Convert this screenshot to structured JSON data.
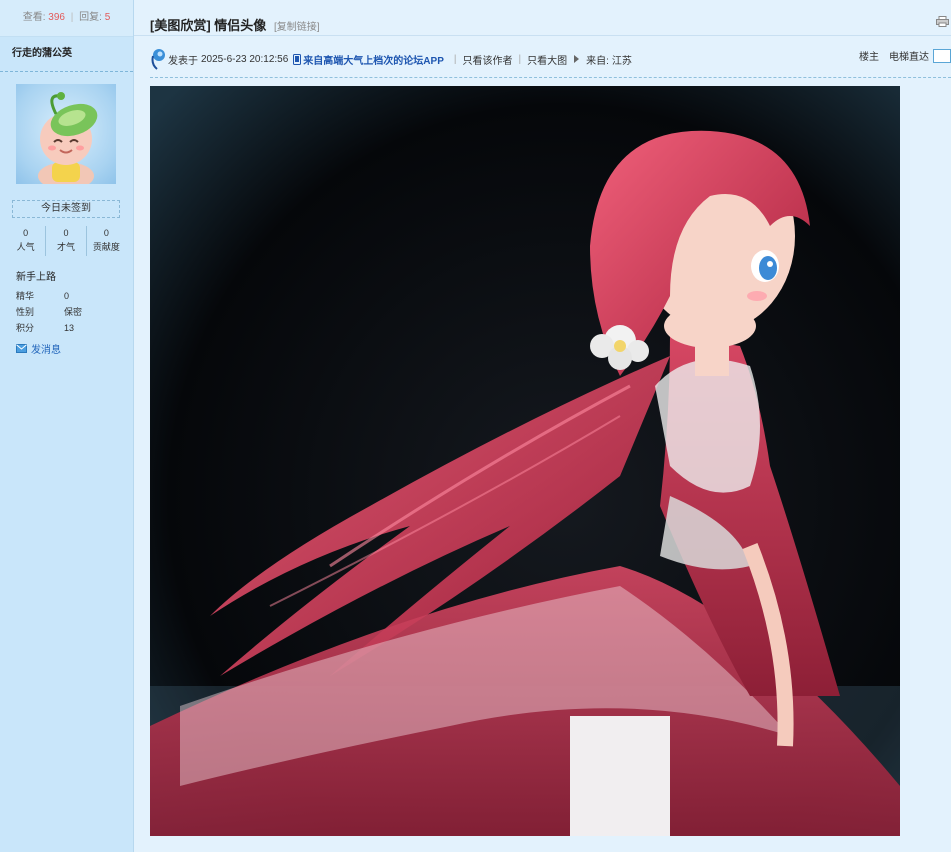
{
  "sidebar": {
    "views_label": "查看:",
    "views": "396",
    "replies_label": "回复:",
    "replies": "5",
    "username": "行走的蒲公英",
    "signin": "今日未签到",
    "stats": [
      {
        "value": "0",
        "label": "人气"
      },
      {
        "value": "0",
        "label": "才气"
      },
      {
        "value": "0",
        "label": "贡献度"
      }
    ],
    "rank": "新手上路",
    "info": [
      {
        "key": "精华",
        "value": "0"
      },
      {
        "key": "性别",
        "value": "保密"
      },
      {
        "key": "积分",
        "value": "13"
      }
    ],
    "pm_label": "发消息"
  },
  "post": {
    "category": "[美图欣赏]",
    "title": "情侣头像",
    "copy_link": "[复制链接]",
    "posted_prefix": "发表于",
    "posted_time": "2025-6-23 20:12:56",
    "app_link": "来自高端大气上档次的论坛APP",
    "only_author": "只看该作者",
    "only_big_image": "只看大图",
    "from_label": "来自:",
    "from_location": "江苏",
    "floor": "楼主",
    "elevator": "电梯直达"
  },
  "colors": {
    "accent_red": "#e25a5a",
    "link_blue": "#1e56b0",
    "sidebar_bg": "#c9e6fa",
    "main_bg": "#e3f2fd"
  }
}
